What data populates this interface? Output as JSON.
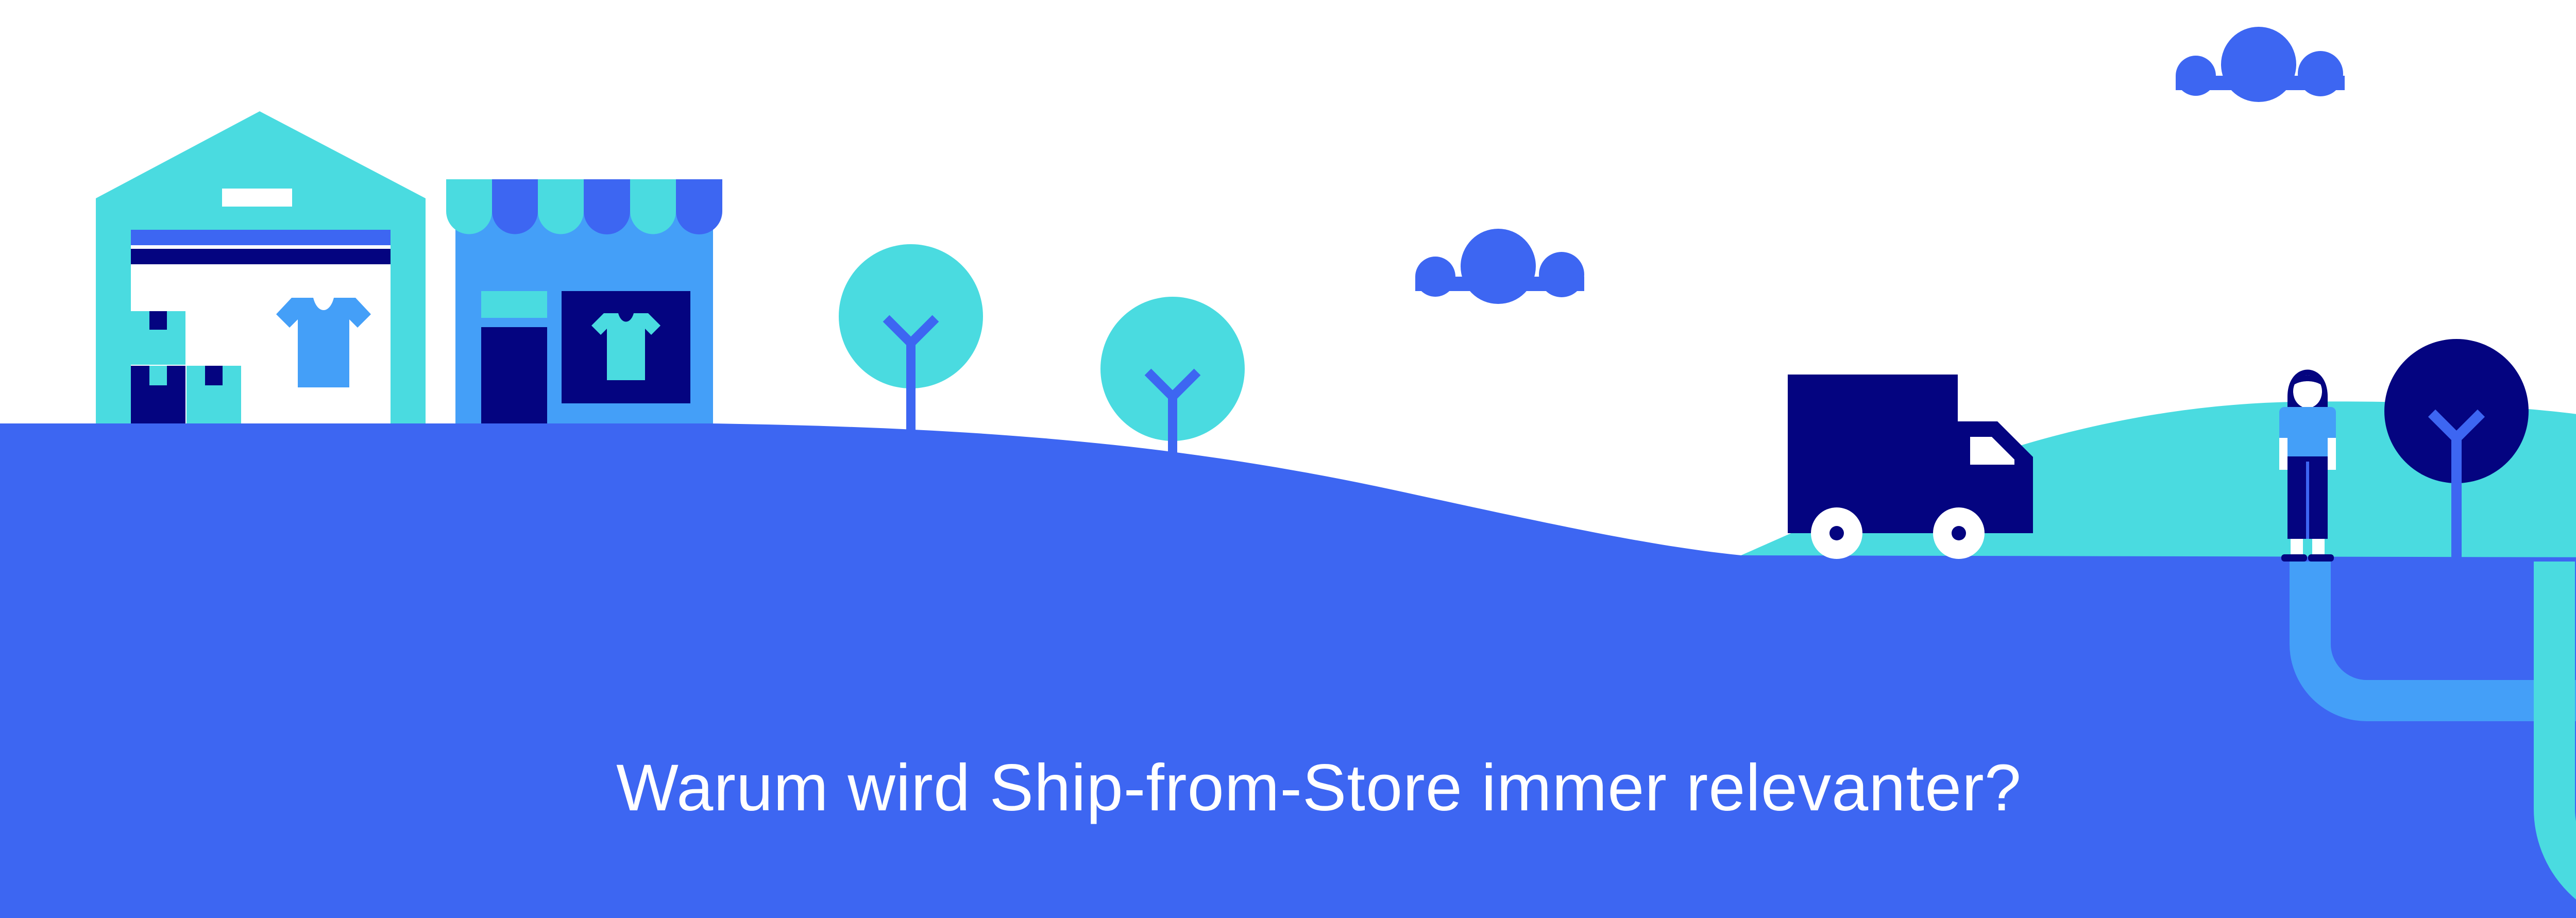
{
  "headline": "Warum wird Ship-from-Store immer relevanter?",
  "colors": {
    "background": "#ffffff",
    "ground_blue": "#3d66f2",
    "turquoise": "#4adbe0",
    "light_blue": "#449ff8",
    "navy": "#040480",
    "white": "#ffffff"
  },
  "icons": [
    "warehouse-icon",
    "store-icon",
    "t-shirt-icon",
    "tree-icon",
    "cloud-icon",
    "delivery-truck-icon",
    "person-icon",
    "pipe-icon"
  ]
}
